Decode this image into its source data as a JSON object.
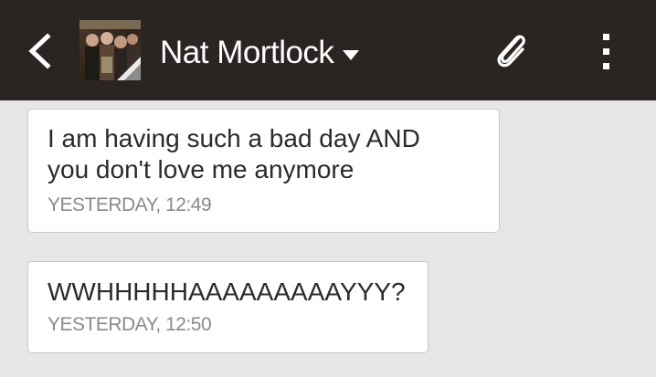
{
  "header": {
    "contact_name": "Nat Mortlock",
    "back_icon": "chevron-left-icon",
    "dropdown_icon": "caret-down-icon",
    "attach_icon": "paperclip-icon",
    "menu_icon": "overflow-menu-icon"
  },
  "messages": [
    {
      "lines": [
        "I am having such a bad day AND",
        "you don't love me anymore"
      ],
      "timestamp": "YESTERDAY, 12:49"
    },
    {
      "lines": [
        "WWHHHHHAAAAAAAAAYYY?"
      ],
      "timestamp": "YESTERDAY, 12:50"
    }
  ],
  "colors": {
    "appbar": "#2a2522",
    "background": "#e6e6e6",
    "bubble": "#ffffff",
    "message_text": "#2b2b2b",
    "timestamp_text": "#8a8a8a"
  }
}
